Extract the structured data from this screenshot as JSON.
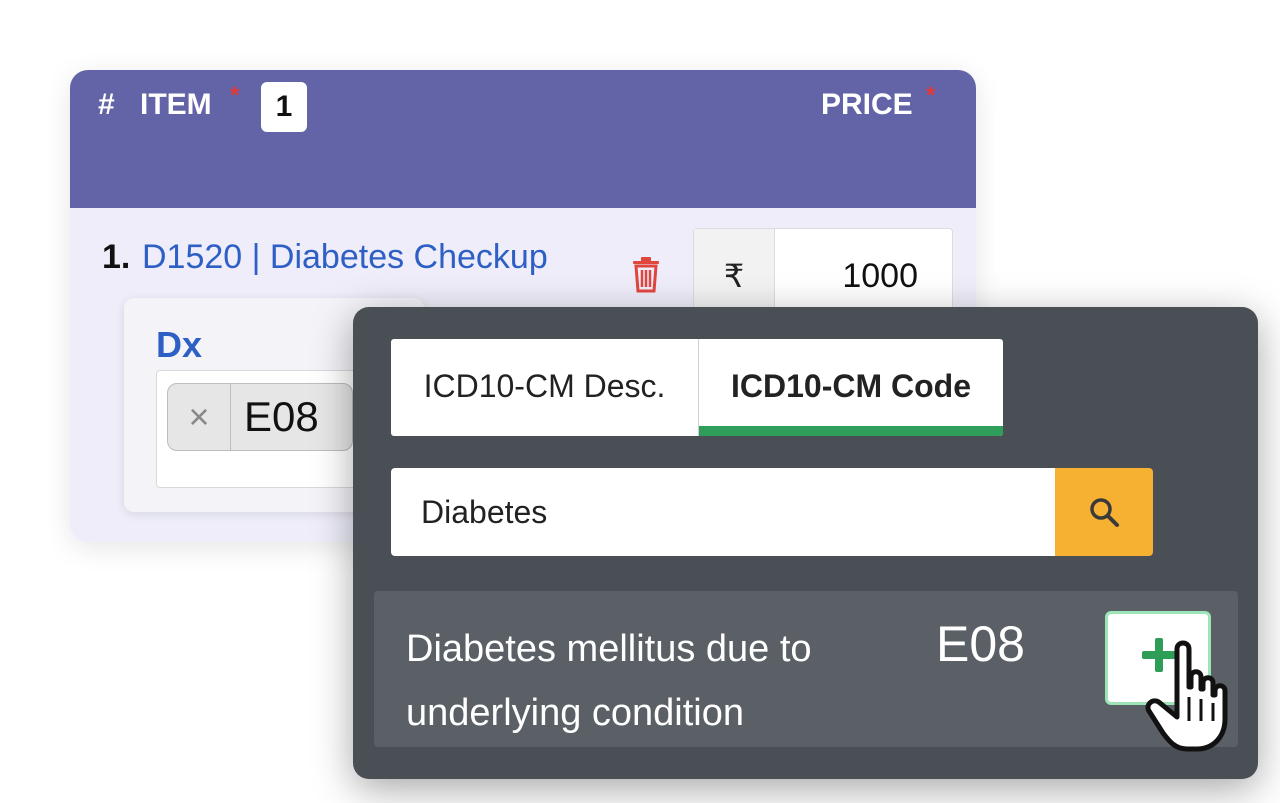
{
  "header": {
    "hash": "#",
    "item_label": "ITEM",
    "required_mark": "*",
    "item_count": "1",
    "price_label": "PRICE"
  },
  "row": {
    "number": "1.",
    "title": "D1520 | Diabetes Checkup",
    "currency": "₹",
    "price": "1000"
  },
  "dx": {
    "label": "Dx",
    "remove_symbol": "×",
    "tag": "E08"
  },
  "popup": {
    "tabs": [
      {
        "label": "ICD10-CM Desc.",
        "active": false
      },
      {
        "label": "ICD10-CM Code",
        "active": true
      }
    ],
    "search_value": "Diabetes",
    "result": {
      "description": "Diabetes mellitus due to underlying condition",
      "code": "E08"
    }
  },
  "colors": {
    "header_purple": "#6264a7",
    "link_blue": "#2d5fc4",
    "active_tab_green": "#2f9e5b",
    "search_orange": "#f6b133",
    "required_red": "#e03a3a"
  },
  "icons": [
    "trash-icon",
    "search-icon",
    "plus-icon",
    "hand-cursor-icon",
    "close-icon"
  ]
}
